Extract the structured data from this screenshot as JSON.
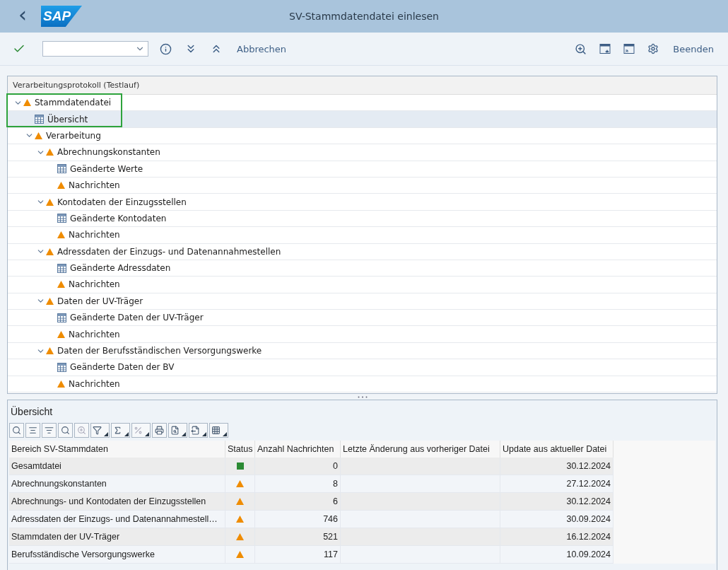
{
  "header": {
    "back": "‹",
    "logo": "SAP",
    "title": "SV-Stammdatendatei einlesen"
  },
  "toolbar": {
    "left_buttons": [
      "Abbrechen"
    ],
    "right_buttons": [
      "Beenden"
    ]
  },
  "tree": {
    "heading": "Verarbeitungsprotokoll (Testlauf)",
    "nodes": [
      {
        "label": "Stammdatendatei",
        "kind": "warning",
        "expanded": true,
        "selected": false,
        "children": [
          {
            "label": "Übersicht",
            "kind": "table",
            "selected": true
          },
          {
            "label": "Verarbeitung",
            "kind": "warning",
            "expanded": true,
            "selected": false,
            "children": [
              {
                "label": "Abrechnungskonstanten",
                "kind": "warning",
                "expanded": true,
                "selected": false,
                "children": [
                  {
                    "label": "Geänderte Werte",
                    "kind": "table",
                    "selected": false
                  },
                  {
                    "label": "Nachrichten",
                    "kind": "warning",
                    "selected": false
                  }
                ]
              },
              {
                "label": "Kontodaten der Einzugsstellen",
                "kind": "warning",
                "expanded": true,
                "selected": false,
                "children": [
                  {
                    "label": "Geänderte Kontodaten",
                    "kind": "table",
                    "selected": false
                  },
                  {
                    "label": "Nachrichten",
                    "kind": "warning",
                    "selected": false
                  }
                ]
              },
              {
                "label": "Adressdaten der Einzugs- und Datenannahmestellen",
                "kind": "warning",
                "expanded": true,
                "selected": false,
                "children": [
                  {
                    "label": "Geänderte Adressdaten",
                    "kind": "table",
                    "selected": false
                  },
                  {
                    "label": "Nachrichten",
                    "kind": "warning",
                    "selected": false
                  }
                ]
              },
              {
                "label": "Daten der UV-Träger",
                "kind": "warning",
                "expanded": true,
                "selected": false,
                "children": [
                  {
                    "label": "Geänderte Daten der UV-Träger",
                    "kind": "table",
                    "selected": false
                  },
                  {
                    "label": "Nachrichten",
                    "kind": "warning",
                    "selected": false
                  }
                ]
              },
              {
                "label": "Daten der Berufsständischen Versorgungswerke",
                "kind": "warning",
                "expanded": true,
                "selected": false,
                "children": [
                  {
                    "label": "Geänderte Daten der BV",
                    "kind": "table",
                    "selected": false
                  },
                  {
                    "label": "Nachrichten",
                    "kind": "warning",
                    "selected": false
                  }
                ]
              }
            ]
          }
        ]
      }
    ]
  },
  "overview": {
    "title": "Übersicht",
    "table": {
      "columns": [
        "Bereich SV-Stammdaten",
        "Status",
        "Anzahl Nachrichten",
        "Letzte Änderung aus vorheriger Datei",
        "Update aus aktueller Datei"
      ],
      "rows": [
        {
          "area": "Gesamtdatei",
          "kind": "success",
          "count": "0",
          "update": "30.12.2024"
        },
        {
          "area": "Abrechnungskonstanten",
          "kind": "warning",
          "count": "8",
          "update": "27.12.2024"
        },
        {
          "area": "Abrechnungs- und Kontodaten der Einzugsstellen",
          "kind": "warning",
          "count": "6",
          "update": "30.12.2024"
        },
        {
          "area": "Adressdaten der Einzugs- und Datenannahmestell…",
          "kind": "warning",
          "count": "746",
          "update": "30.09.2024"
        },
        {
          "area": "Stammdaten der UV-Träger",
          "kind": "warning",
          "count": "521",
          "update": "16.12.2024"
        },
        {
          "area": "Berufsständische Versorgungswerke",
          "kind": "warning",
          "count": "117",
          "update": "10.09.2024"
        }
      ]
    }
  }
}
